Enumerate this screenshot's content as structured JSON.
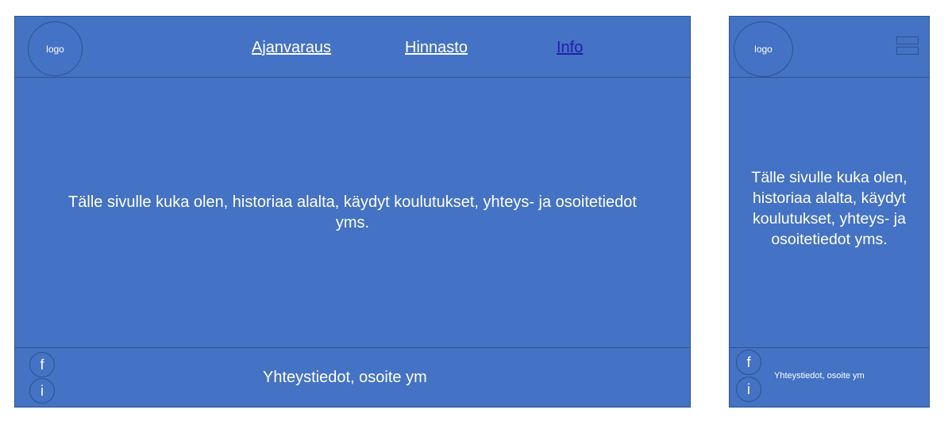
{
  "desktop": {
    "logo": "logo",
    "nav": {
      "ajanvaraus": "Ajanvaraus",
      "hinnasto": "Hinnasto",
      "info": "Info"
    },
    "main_text": "Tälle sivulle kuka olen, historiaa alalta, käydyt koulutukset, yhteys- ja osoitetiedot yms.",
    "footer": {
      "facebook": "f",
      "instagram": "i",
      "contact": "Yhteystiedot, osoite ym"
    }
  },
  "mobile": {
    "logo": "logo",
    "menu_icon": "hamburger-icon",
    "main_text": "Tälle sivulle kuka olen, historiaa alalta, käydyt koulutukset, yhteys- ja osoitetiedot yms.",
    "footer": {
      "facebook": "f",
      "instagram": "i",
      "contact": "Yhteystiedot, osoite ym"
    }
  },
  "colors": {
    "panel": "#4472c4",
    "border": "#2f528f",
    "active_link": "#1f1fa8",
    "text": "#ffffff"
  }
}
